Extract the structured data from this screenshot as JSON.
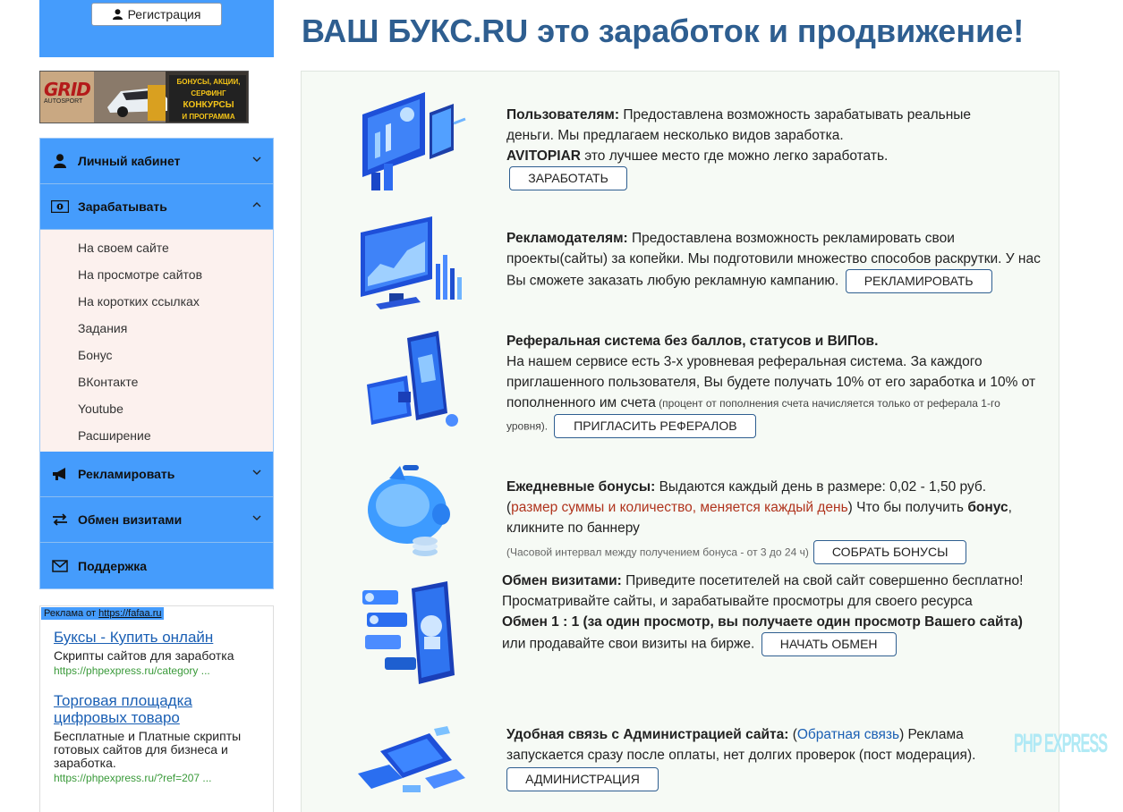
{
  "sidebar": {
    "register_label": "Регистрация",
    "banner": {
      "logo_text": "GRID",
      "logo_sub": "AUTOSPORT",
      "lines": [
        "БОНУСЫ, АКЦИИ, СЕРФИНГ",
        "КОНКУРСЫ",
        "И ПРОГРАММА BOUNTY!"
      ]
    },
    "menu": [
      {
        "label": "Личный кабинет",
        "icon": "user-icon"
      },
      {
        "label": "Зарабатывать",
        "icon": "money-icon"
      },
      {
        "label": "Рекламировать",
        "icon": "megaphone-icon"
      },
      {
        "label": "Обмен визитами",
        "icon": "exchange-icon"
      },
      {
        "label": "Поддержка",
        "icon": "envelope-icon"
      }
    ],
    "submenu": [
      "На своем сайте",
      "На просмотре сайтов",
      "На коротких ссылках",
      "Задания",
      "Бонус",
      "ВКонтакте",
      "Youtube",
      "Расширение"
    ],
    "ads": {
      "label_prefix": "Реклама от",
      "label_link": "https://fafaa.ru",
      "items": [
        {
          "title": "Буксы - Купить онлайн",
          "desc": "Скрипты сайтов для заработка",
          "url": "https://phpexpress.ru/category ..."
        },
        {
          "title": "Торговая площадка цифровых товаро",
          "desc": "Бесплатные и Платные скрипты готовых сайтов для бизнеса и заработка.",
          "url": "https://phpexpress.ru/?ref=207 ..."
        }
      ]
    }
  },
  "main": {
    "title": "ВАШ БУКС.RU это заработок и продвижение!",
    "s1": {
      "bold": "Пользователям:",
      "text": " Предоставлена возможность зарабатывать реальные деньги. Мы предлагаем несколько видов заработка.",
      "bold2": "AVITOPIAR",
      "text2": " это лучшее место где можно легко заработать.",
      "button": "ЗАРАБОТАТЬ"
    },
    "s2": {
      "bold": "Рекламодателям:",
      "text": " Предоставлена возможность рекламировать свои проекты(сайты) за копейки. Мы подготовили множество способов раскрутки. У нас Вы сможете заказать любую рекламную кампанию.",
      "button": "РЕКЛАМИРОВАТЬ"
    },
    "s3": {
      "bold": "Реферальная система без баллов, статусов и ВИПов.",
      "text": "На нашем сервисе есть 3-х уровневая реферальная система. За каждого приглашенного пользователя, Вы будете получать 10% от его заработка и 10% от пополненного им счета",
      "small": " (процент от пополнения счета начисляется только от реферала 1-го уровня).",
      "button": "ПРИГЛАСИТЬ РЕФЕРАЛОВ"
    },
    "s4": {
      "bold": "Ежедневные бонусы:",
      "text": " Выдаются каждый день в размере: 0,02 - 1,50 руб.",
      "red_open": "(",
      "red": "размер суммы и количество, меняется каждый день",
      "after_red": ") Что бы получить ",
      "bold2": "бонус",
      "text2": ", кликните по баннеру",
      "small": "(Часовой интервал между получением бонуса - от 3 до 24 ч)",
      "button": "СОБРАТЬ БОНУСЫ"
    },
    "s5": {
      "bold": "Обмен визитами:",
      "text": " Приведите посетителей на свой сайт совершенно бесплатно! Просматривайте сайты, и зарабатывайте просмотры для своего ресурса",
      "bold2": "Обмен 1 : 1 (за один просмотр, вы получаете один просмотр Вашего сайта)",
      "text2": " или продавайте свои визиты на бирже.",
      "button": "НАЧАТЬ ОБМЕН"
    },
    "s6": {
      "bold": "Удобная связь с Администрацией сайта:",
      "open": " (",
      "link": "Обратная связь",
      "text": ") Реклама запускается сразу после оплаты, нет долгих проверок (пост модерация).",
      "button": "АДМИНИСТРАЦИЯ"
    }
  },
  "watermark": "PHP EXPRESS",
  "colors": {
    "accent": "#459cfc",
    "title": "#2e5e90",
    "submenu_bg": "#fcf1ee",
    "panel_bg": "#f6faf5",
    "highlight": "#b0341d"
  }
}
